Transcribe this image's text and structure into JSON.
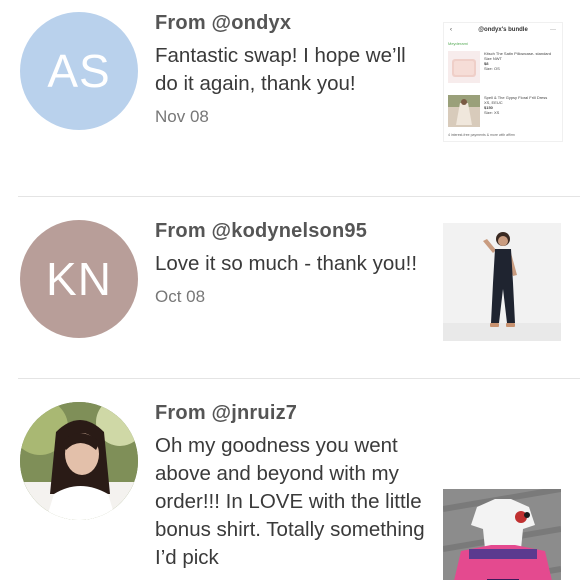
{
  "reviews": [
    {
      "from": "From @ondyx",
      "message": "Fantastic swap! I hope we’ll do it again, thank you!",
      "date": "Nov 08",
      "avatar": {
        "initials": "AS",
        "color": "#b9d1ec"
      },
      "thumb": {
        "title": "@ondyx's bundle",
        "user": "Meyderami",
        "items": [
          {
            "name": "Kitsch The Satin Pillowcase- standard Size NWT",
            "price": "$8",
            "size": "Size: OS"
          },
          {
            "name": "Spell & The Gypsy Floral Frill Dress XS, EEUC",
            "price": "$150",
            "size": "Size: XS"
          }
        ],
        "footer": "4 interest-free payments & more with affirm"
      }
    },
    {
      "from": "From @kodynelson95",
      "message": "Love it so much - thank you!!",
      "date": "Oct 08",
      "avatar": {
        "initials": "KN",
        "color": "#b89e99"
      }
    },
    {
      "from": "From @jnruiz7",
      "message": "Oh my goodness you went above and beyond with my order!!! In LOVE with the little bonus shirt. Totally something I’d pick",
      "date": ""
    }
  ]
}
